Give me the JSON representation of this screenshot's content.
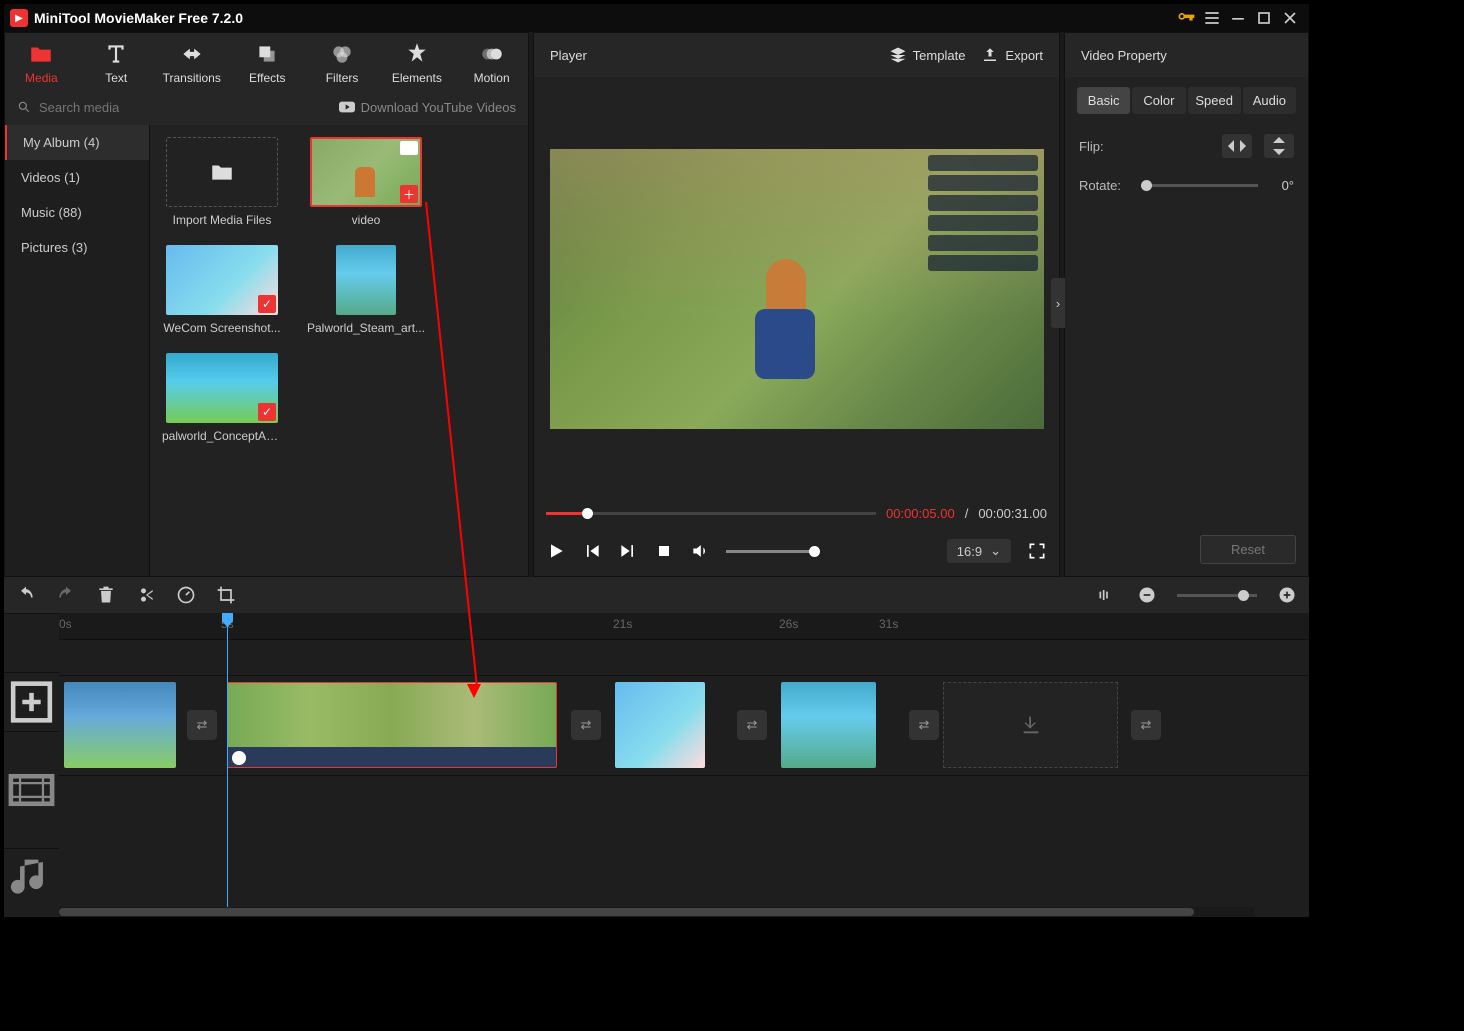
{
  "titlebar": {
    "title": "MiniTool MovieMaker Free 7.2.0"
  },
  "tabs": [
    {
      "label": "Media",
      "active": true
    },
    {
      "label": "Text"
    },
    {
      "label": "Transitions"
    },
    {
      "label": "Effects"
    },
    {
      "label": "Filters"
    },
    {
      "label": "Elements"
    },
    {
      "label": "Motion"
    }
  ],
  "search": {
    "placeholder": "Search media",
    "download": "Download YouTube Videos"
  },
  "sidebar": {
    "items": [
      {
        "label": "My Album (4)",
        "active": true
      },
      {
        "label": "Videos (1)"
      },
      {
        "label": "Music (88)"
      },
      {
        "label": "Pictures (3)"
      }
    ]
  },
  "media": {
    "import": "Import Media Files",
    "items": [
      {
        "label": "video",
        "kind": "video",
        "selected": true
      },
      {
        "label": "WeCom Screenshot...",
        "kind": "image"
      },
      {
        "label": "Palworld_Steam_art...",
        "kind": "image"
      },
      {
        "label": "palworld_ConceptArt...",
        "kind": "image"
      }
    ]
  },
  "player": {
    "title": "Player",
    "template": "Template",
    "export": "Export",
    "current": "00:00:05.00",
    "total": "00:00:31.00",
    "sep": "/",
    "aspect": "16:9"
  },
  "props": {
    "title": "Video Property",
    "tabs": [
      "Basic",
      "Color",
      "Speed",
      "Audio"
    ],
    "flip": "Flip:",
    "rotate": "Rotate:",
    "rotate_val": "0°",
    "reset": "Reset"
  },
  "ruler": {
    "ticks": [
      {
        "label": "0s",
        "pos": 0
      },
      {
        "label": "5s",
        "pos": 168
      },
      {
        "label": "21s",
        "pos": 560
      },
      {
        "label": "26s",
        "pos": 728
      },
      {
        "label": "31s",
        "pos": 828
      }
    ]
  }
}
